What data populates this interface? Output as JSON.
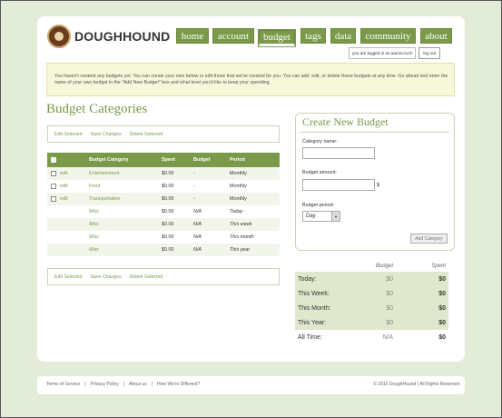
{
  "brand": {
    "name": "DOUGHHOUND"
  },
  "nav": [
    {
      "label": "home",
      "active": false
    },
    {
      "label": "account",
      "active": false
    },
    {
      "label": "budget",
      "active": true
    },
    {
      "label": "tags",
      "active": false
    },
    {
      "label": "data",
      "active": false
    },
    {
      "label": "community",
      "active": false
    },
    {
      "label": "about",
      "active": false
    }
  ],
  "session": {
    "status_text": "you are logged in as aaronccuch",
    "logout_label": "log out"
  },
  "notice": "You haven't created any budgets yet. You can create your own below or edit those that we've created for you. You can add, edit, or delete these budgets at any time. Go ahead and enter the name of your own budget in the \"Add New Budget\" box and what level you'd like to keep your spending.",
  "categories": {
    "title": "Budget Categories",
    "actions": [
      "Edit Selected",
      "Save Changes",
      "Delete Selected"
    ],
    "columns": [
      "Budget Category",
      "Spent",
      "Budget",
      "Period"
    ],
    "edit_label": "edit",
    "rows": [
      {
        "category": "Entertainment",
        "spent": "$0.00",
        "budget": "-",
        "period": "Monthly"
      },
      {
        "category": "Food",
        "spent": "$0.00",
        "budget": "-",
        "period": "Monthly"
      },
      {
        "category": "Transportation",
        "spent": "$0.00",
        "budget": "-",
        "period": "Monthly"
      },
      {
        "category": "Misc",
        "spent": "$0.00",
        "budget": "N/A",
        "period": "Today"
      },
      {
        "category": "Misc",
        "spent": "$0.00",
        "budget": "N/A",
        "period": "This week"
      },
      {
        "category": "Misc",
        "spent": "$0.00",
        "budget": "N/A",
        "period": "This month"
      },
      {
        "category": "Misc",
        "spent": "$0.00",
        "budget": "N/A",
        "period": "This year"
      }
    ]
  },
  "create": {
    "title": "Create New Budget",
    "name_label": "Category name:",
    "amount_label": "Budget amount:",
    "currency": "$",
    "period_label": "Budget period:",
    "period_value": "Day",
    "add_label": "Add Category"
  },
  "summary": {
    "headers": [
      "Budget",
      "Spent"
    ],
    "rows": [
      {
        "label": "Today:",
        "budget": "$0",
        "spent": "$0"
      },
      {
        "label": "This Week:",
        "budget": "$0",
        "spent": "$0"
      },
      {
        "label": "This Month:",
        "budget": "$0",
        "spent": "$0"
      },
      {
        "label": "This Year:",
        "budget": "$0",
        "spent": "$0"
      },
      {
        "label": "All Time:",
        "budget": "N/A",
        "spent": "$0"
      }
    ]
  },
  "footer": {
    "links": [
      "Terms of Service",
      "Privacy Policy",
      "About us",
      "How We're Different?"
    ],
    "separator": "|",
    "copyright": "© 2010 DoughHound | All Rights Reserved"
  },
  "colors": {
    "accent": "#7a9a4a",
    "background": "#e3ecd8",
    "notice_bg": "#f7f7d9"
  }
}
